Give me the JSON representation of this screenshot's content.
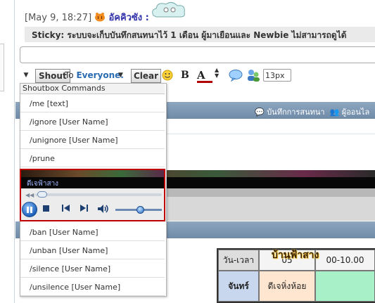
{
  "message": {
    "timestamp": "[May 9, 18:27]",
    "username": "อัคคิวซัง :"
  },
  "sticky": {
    "text": "Sticky: ระบบจะเก็บบันทึกสนทนาไว้ 1 เดือน ผู้มาเยือนและ Newbie ไม่สามารถดูได้"
  },
  "toolbar": {
    "shout_label": "Shout",
    "to_prefix": "To ",
    "to_target": "Everyone.",
    "clear_label": "Clear",
    "bold_label": "B",
    "color_label": "A",
    "font_size": "13px"
  },
  "panel": {
    "history_link": "บันทึกการสนทนา",
    "online_link": "ผู้ออนไล"
  },
  "commands": {
    "header": "Shoutbox Commands",
    "items": [
      "/me [text]",
      "/ignore [User Name]",
      "/unignore [User Name]",
      "/prune",
      "/ban [User Name]",
      "/unban [User Name]",
      "/silence [User Name]",
      "/unsilence [User Name]"
    ]
  },
  "player": {
    "track_title": "ดีเจฟ้าสาง",
    "progress": 0.02,
    "volume": 0.5
  },
  "schedule": {
    "banner": "บ้านฟ้าสาง",
    "header_day_time": "วัน-เวลา",
    "header_time1": "05",
    "header_time2": "00-10.00",
    "day": "จันทร์",
    "show": "ดีเจหิ่งห้อย"
  },
  "colors": {
    "accent": "#2a6bb2",
    "player_border": "#c00000",
    "panel_bar": "#7b95b1"
  }
}
